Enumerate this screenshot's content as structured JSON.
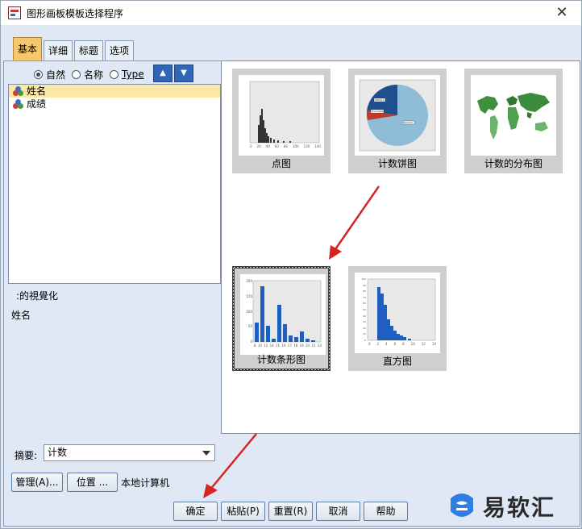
{
  "window": {
    "title": "图形画板模板选择程序"
  },
  "tabs": [
    {
      "label": "基本",
      "active": true
    },
    {
      "label": "详细",
      "active": false
    },
    {
      "label": "标题",
      "active": false
    },
    {
      "label": "选项",
      "active": false
    }
  ],
  "sort": {
    "options": [
      "自然",
      "名称",
      "Type"
    ],
    "selected": "自然"
  },
  "variables": [
    {
      "name": "姓名",
      "selected": true
    },
    {
      "name": "成绩",
      "selected": false
    }
  ],
  "visualization": {
    "label": ":的視覺化",
    "value": "姓名"
  },
  "summary": {
    "label": "摘要:",
    "value": "计数"
  },
  "buttons": {
    "manage": "管理(A)...",
    "location": "位置 ...",
    "location_value": "本地计算机",
    "ok": "确定",
    "paste": "粘贴(P)",
    "reset": "重置(R)",
    "cancel": "取消",
    "help": "帮助"
  },
  "gallery": [
    {
      "caption": "点图",
      "kind": "dot",
      "selected": false
    },
    {
      "caption": "计数饼图",
      "kind": "pie",
      "selected": false
    },
    {
      "caption": "计数的分布图",
      "kind": "map",
      "selected": false
    },
    {
      "caption": "计数条形图",
      "kind": "bar",
      "selected": true
    },
    {
      "caption": "直方图",
      "kind": "histogram",
      "selected": false
    }
  ],
  "thumb_axes": {
    "dot_x": [
      "0",
      "20",
      "40",
      "60",
      "80",
      "100",
      "120",
      "140"
    ],
    "bar_x": [
      "8",
      "10",
      "12",
      "14",
      "15",
      "16",
      "17",
      "18",
      "19",
      "20",
      "21",
      "23"
    ],
    "bar_y": [
      "200",
      "150",
      "100",
      "50",
      "0"
    ],
    "hist_x": [
      "0",
      "2",
      "4",
      "6",
      "8",
      "10",
      "12",
      "14"
    ],
    "hist_y": [
      "100",
      "90",
      "80",
      "70",
      "60",
      "50",
      "40",
      "30",
      "20",
      "10",
      "0"
    ],
    "pie_labels": [
      "Midterm",
      "Trunctated",
      "Normal"
    ]
  },
  "watermark": {
    "text": "易软汇"
  },
  "colors": {
    "tab_active": "#f6c86d",
    "bar_blue": "#1f5fbf",
    "annotation_red": "#d62424"
  }
}
